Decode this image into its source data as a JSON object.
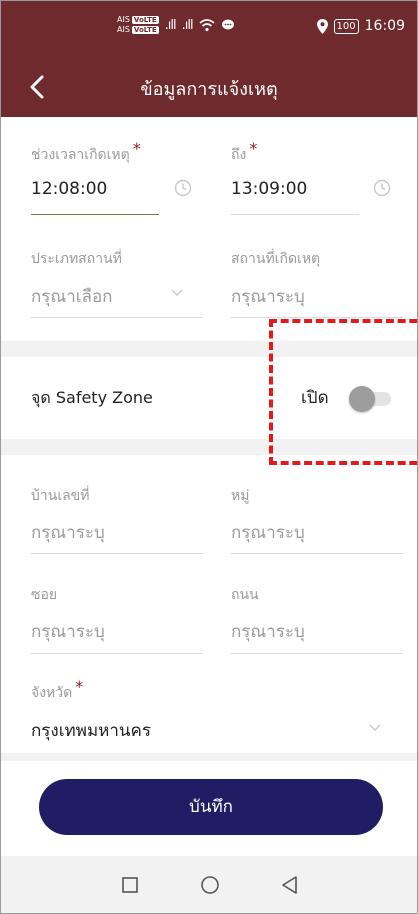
{
  "status_bar": {
    "carrier_1": "AIS",
    "carrier_1_badge": "VoLTE",
    "carrier_2": "AIS",
    "carrier_2_badge": "VoLTE",
    "battery": "100",
    "time": "16:09"
  },
  "header": {
    "title": "ข้อมูลการแจ้งเหตุ",
    "back_icon": "chevron-left-icon"
  },
  "form": {
    "time_range": {
      "label": "ช่วงเวลาเกิดเหตุ",
      "required_mark": "*",
      "value": "12:08:00"
    },
    "time_to": {
      "label": "ถึง",
      "required_mark": "*",
      "value": "13:09:00"
    },
    "place_type": {
      "label": "ประเภทสถานที่",
      "placeholder": "กรุณาเลือก"
    },
    "place": {
      "label": "สถานที่เกิดเหตุ",
      "placeholder": "กรุณาระบุ"
    },
    "safety_zone": {
      "label": "จุด Safety Zone",
      "toggle_label": "เปิด",
      "enabled": false
    },
    "house_no": {
      "label": "บ้านเลขที่",
      "placeholder": "กรุณาระบุ"
    },
    "village_no": {
      "label": "หมู่",
      "placeholder": "กรุณาระบุ"
    },
    "soi": {
      "label": "ซอย",
      "placeholder": "กรุณาระบุ"
    },
    "road": {
      "label": "ถนน",
      "placeholder": "กรุณาระบุ"
    },
    "province": {
      "label": "จังหวัด",
      "required_mark": "*",
      "value": "กรุงเทพมหานคร"
    }
  },
  "save_button": "บันทึก",
  "colors": {
    "header": "#6e2a2c",
    "button": "#1f1d63",
    "required": "#8a1f2b",
    "highlight": "#e01b1b"
  }
}
